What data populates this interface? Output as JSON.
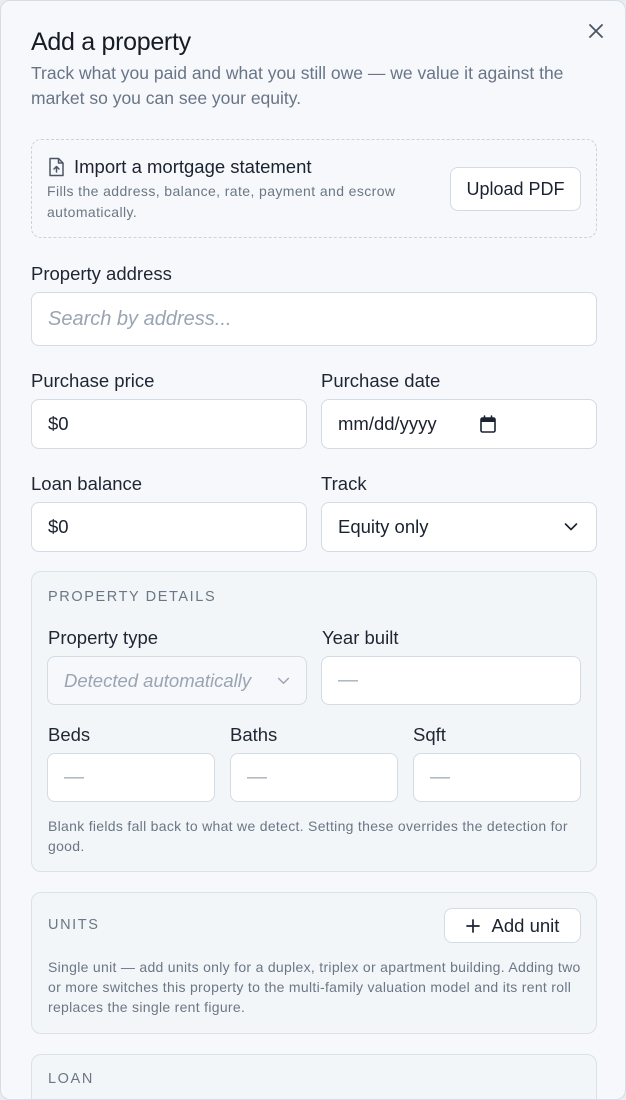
{
  "modal": {
    "title": "Add a property",
    "subtitle": "Track what you paid and what you still owe — we value it against the market so you can see your equity."
  },
  "import": {
    "title": "Import a mortgage statement",
    "description": "Fills the address, balance, rate, payment and escrow automatically.",
    "button_label": "Upload PDF"
  },
  "address": {
    "label": "Property address",
    "placeholder": "Search by address..."
  },
  "purchase_price": {
    "label": "Purchase price",
    "value": "$0"
  },
  "purchase_date": {
    "label": "Purchase date",
    "value": "mm/dd/yyyy"
  },
  "loan_balance": {
    "label": "Loan balance",
    "value": "$0"
  },
  "track": {
    "label": "Track",
    "value": "Equity only"
  },
  "property_details": {
    "section_title": "PROPERTY DETAILS",
    "property_type": {
      "label": "Property type",
      "placeholder": "Detected automatically"
    },
    "year_built": {
      "label": "Year built",
      "value": "—"
    },
    "beds": {
      "label": "Beds",
      "value": "—"
    },
    "baths": {
      "label": "Baths",
      "value": "—"
    },
    "sqft": {
      "label": "Sqft",
      "value": "—"
    },
    "note": "Blank fields fall back to what we detect. Setting these overrides the detection for good."
  },
  "units": {
    "section_title": "UNITS",
    "add_button_label": "Add unit",
    "note": "Single unit — add units only for a duplex, triplex or apartment building. Adding two or more switches this property to the multi-family valuation model and its rent roll replaces the single rent figure."
  },
  "loan": {
    "section_title": "LOAN"
  },
  "icons": {
    "close": "close-icon",
    "file_upload": "file-upload-icon",
    "calendar": "calendar-icon",
    "chevron": "chevron-down-icon",
    "plus": "plus-icon"
  }
}
